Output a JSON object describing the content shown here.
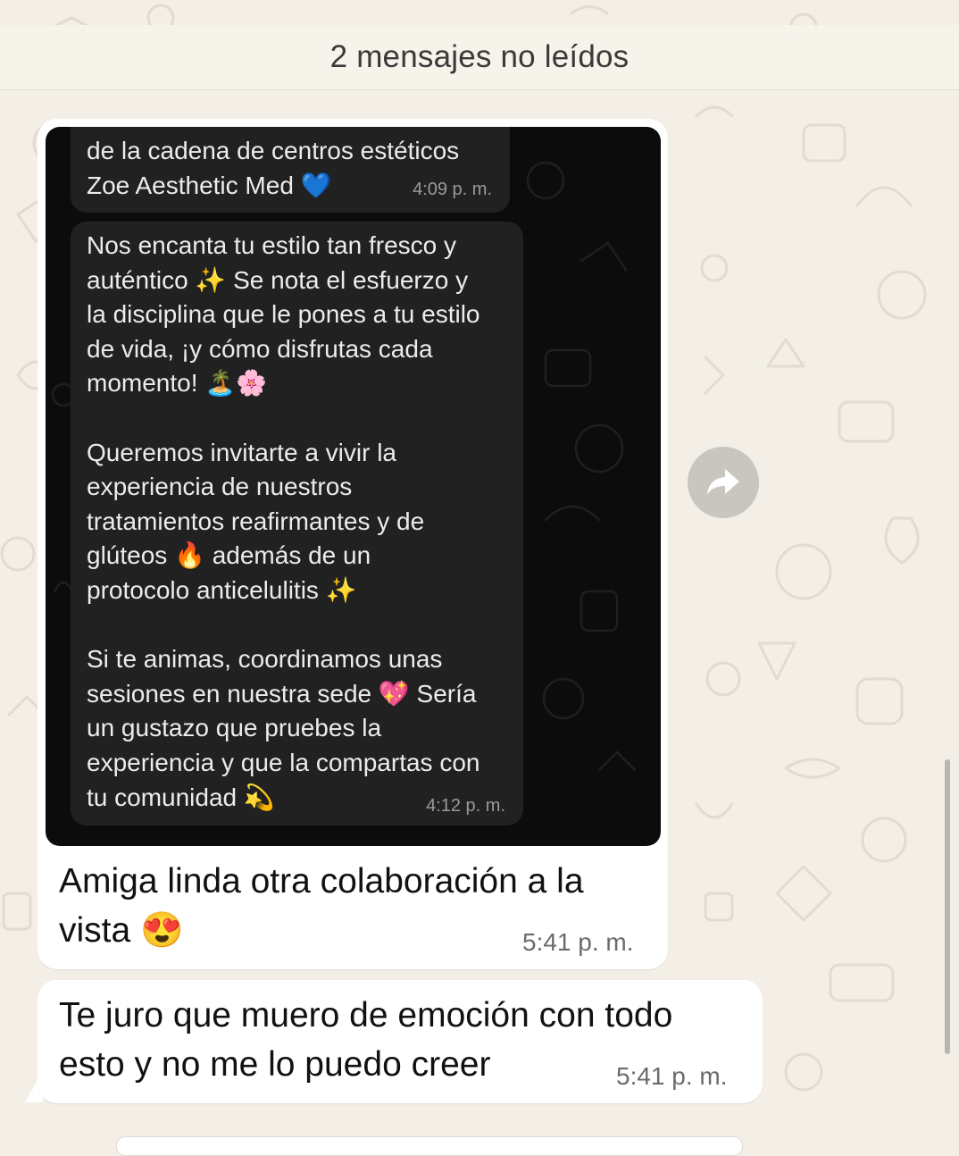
{
  "banner": {
    "unread_label": "2 mensajes no leídos"
  },
  "message_1": {
    "screenshot": {
      "bubble_a_text": "de la cadena de centros estéticos\nZoe Aesthetic Med 💙",
      "bubble_a_time": "4:09 p. m.",
      "bubble_b_text": "Nos encanta tu estilo tan fresco y\nauténtico ✨ Se nota el esfuerzo y\nla disciplina que le pones a tu estilo\nde vida, ¡y cómo disfrutas cada\nmomento! 🏝️🌸\n\nQueremos invitarte a vivir la\nexperiencia de nuestros\ntratamientos reafirmantes y de\nglúteos 🔥 además de un\nprotocolo anticelulitis ✨\n\nSi te animas, coordinamos unas\nsesiones en nuestra sede 💖 Sería\nun gustazo que pruebes la\nexperiencia y que la compartas con\ntu comunidad 💫",
      "bubble_b_time": "4:12 p. m."
    },
    "caption": "Amiga linda otra colaboración a la\nvista 😍",
    "time": "5:41 p. m."
  },
  "message_2": {
    "text": "Te juro que muero de emoción con todo\nesto y no me lo puedo creer",
    "time": "5:41 p. m."
  },
  "colors": {
    "wallpaper": "#f3efe7",
    "bubble": "#ffffff",
    "dark_bubble": "#212121",
    "forward_button": "#c9c6c0"
  },
  "icons": {
    "forward": "forward-arrow-icon"
  }
}
